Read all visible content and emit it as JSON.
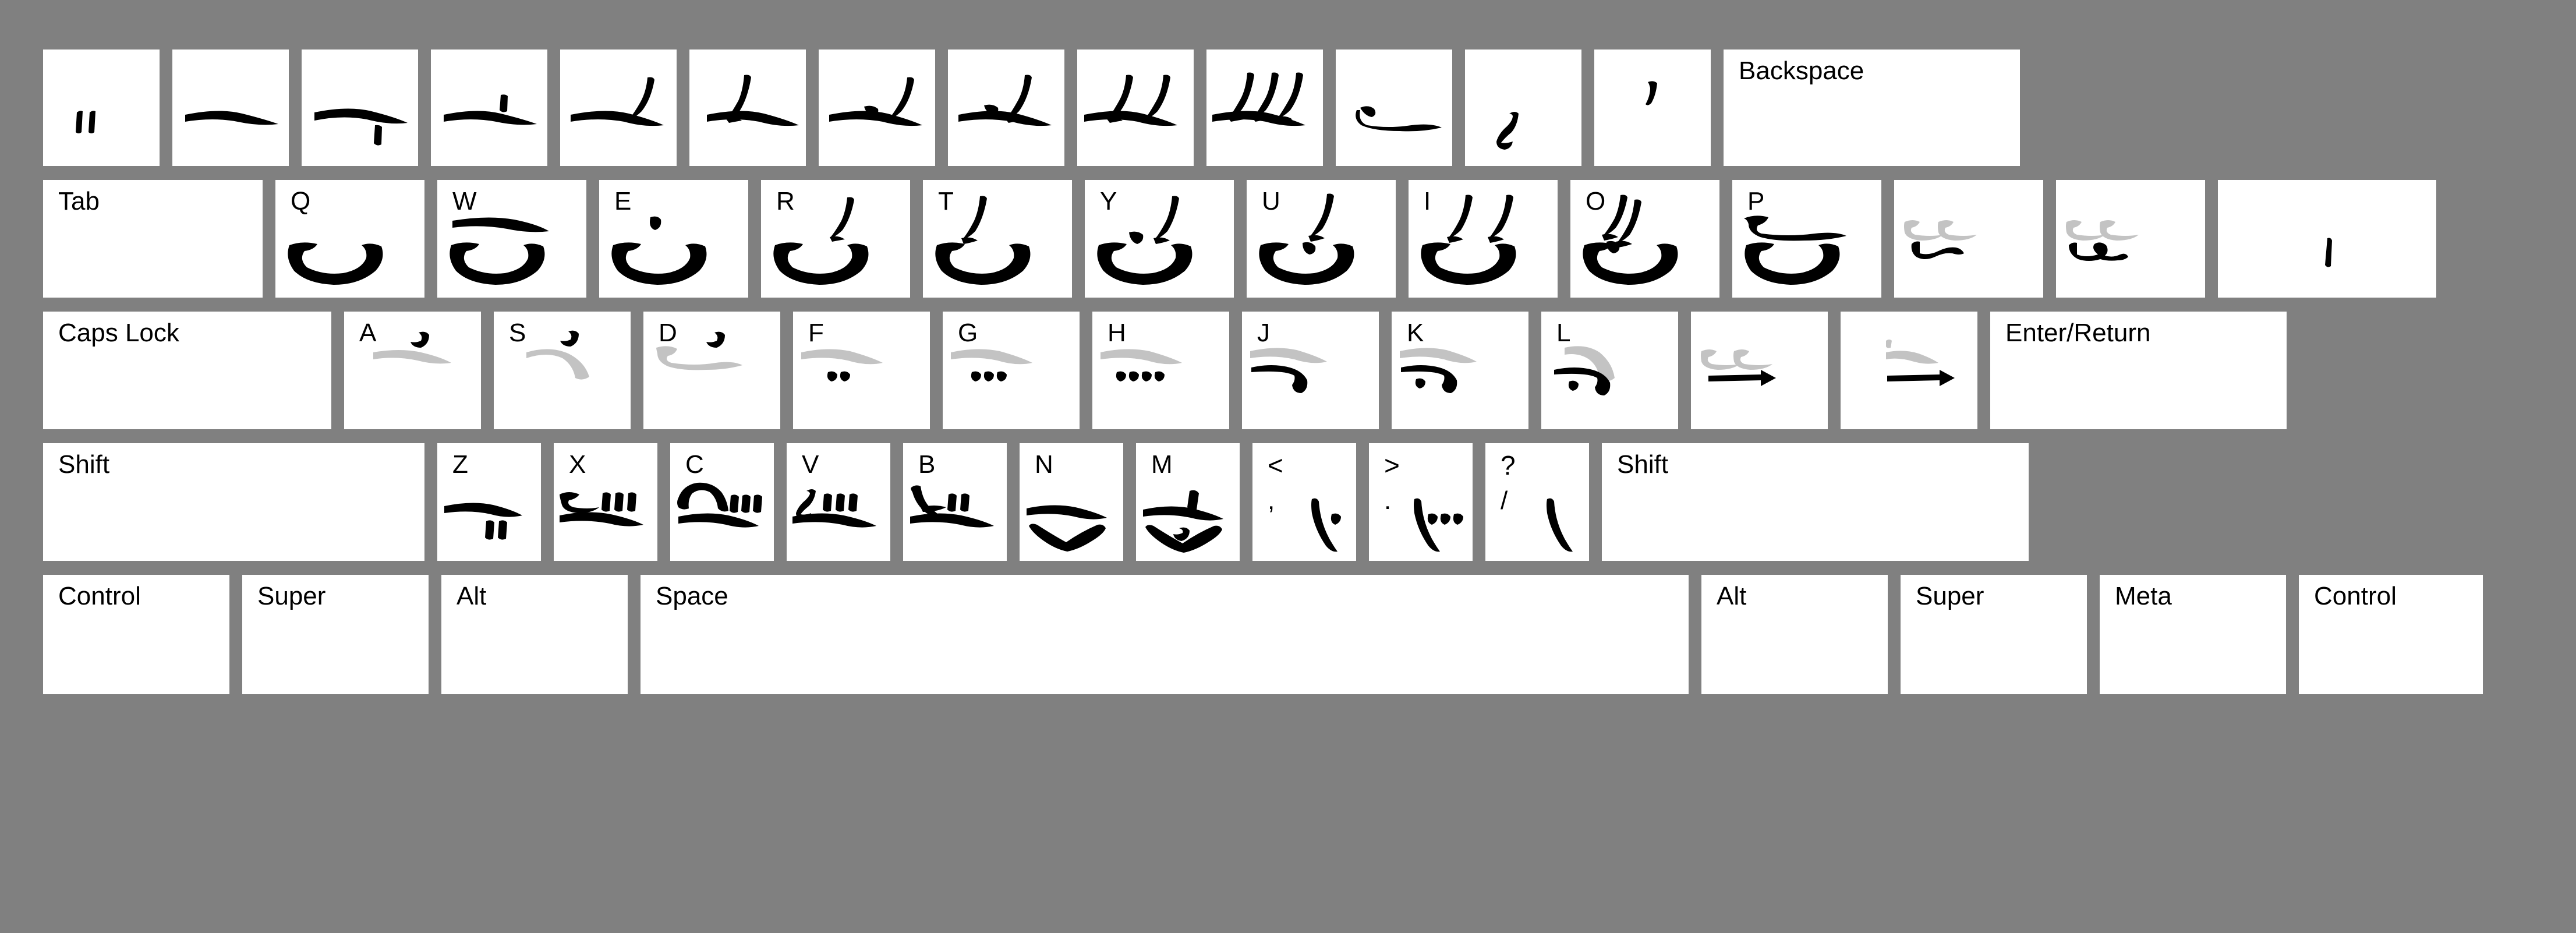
{
  "layout": {
    "name": "shorthand-keyboard",
    "background_color": "#808080",
    "key_color": "#ffffff",
    "ink_color": "#000000",
    "ghost_ink_color": "#c3c3c3",
    "rows": 5
  },
  "rows": [
    {
      "id": "row-number",
      "keys": [
        {
          "id": "k-backtick",
          "label": "",
          "glyph": "two-short-ticks"
        },
        {
          "id": "k-1",
          "label": "",
          "glyph": "long-stroke"
        },
        {
          "id": "k-2",
          "label": "",
          "glyph": "long-stroke-tick-below"
        },
        {
          "id": "k-3",
          "label": "",
          "glyph": "long-stroke-tick-above"
        },
        {
          "id": "k-4",
          "label": "",
          "glyph": "long-stroke-hook-right"
        },
        {
          "id": "k-5",
          "label": "",
          "glyph": "long-stroke-tall-hook"
        },
        {
          "id": "k-6",
          "label": "",
          "glyph": "long-stroke-dot-hook"
        },
        {
          "id": "k-7",
          "label": "",
          "glyph": "long-stroke-hook-mid"
        },
        {
          "id": "k-8",
          "label": "",
          "glyph": "long-stroke-double-hook"
        },
        {
          "id": "k-9",
          "label": "",
          "glyph": "long-stroke-triple-hook"
        },
        {
          "id": "k-0",
          "label": "",
          "glyph": "curved-hook-stroke"
        },
        {
          "id": "k-minus",
          "label": "",
          "glyph": "small-s-curve"
        },
        {
          "id": "k-equal",
          "label": "",
          "glyph": "apostrophe-comma"
        },
        {
          "id": "k-backspace",
          "label": "Backspace",
          "glyph": ""
        }
      ]
    },
    {
      "id": "row-qwerty",
      "keys": [
        {
          "id": "k-tab",
          "label": "Tab",
          "glyph": ""
        },
        {
          "id": "k-q",
          "label": "Q",
          "glyph": "cup-curve"
        },
        {
          "id": "k-w",
          "label": "W",
          "glyph": "bar-over-cup"
        },
        {
          "id": "k-e",
          "label": "E",
          "glyph": "tick-over-cup"
        },
        {
          "id": "k-r",
          "label": "R",
          "glyph": "hook-over-cup"
        },
        {
          "id": "k-t",
          "label": "T",
          "glyph": "tall-hook-over-cup"
        },
        {
          "id": "k-y",
          "label": "Y",
          "glyph": "dot-hook-over-cup"
        },
        {
          "id": "k-u",
          "label": "U",
          "glyph": "hook-dot-over-cup"
        },
        {
          "id": "k-i",
          "label": "I",
          "glyph": "double-hook-over-cup"
        },
        {
          "id": "k-o",
          "label": "O",
          "glyph": "triple-hook-over-cup"
        },
        {
          "id": "k-p",
          "label": "P",
          "glyph": "hook-bar-over-cup"
        },
        {
          "id": "k-lbracket",
          "label": "",
          "glyph": "ghost-pair-over-wave"
        },
        {
          "id": "k-rbracket",
          "label": "",
          "glyph": "ghost-pair-over-loop"
        },
        {
          "id": "k-backslash",
          "label": "",
          "glyph": "vertical-bar"
        }
      ]
    },
    {
      "id": "row-home",
      "keys": [
        {
          "id": "k-capslock",
          "label": "Caps Lock",
          "glyph": ""
        },
        {
          "id": "k-a",
          "label": "A",
          "glyph": "hookmark-over-ghost-stroke"
        },
        {
          "id": "k-s",
          "label": "S",
          "glyph": "hookmark-over-ghost-arc"
        },
        {
          "id": "k-d",
          "label": "D",
          "glyph": "hookmark-over-ghost-hook"
        },
        {
          "id": "k-f",
          "label": "F",
          "glyph": "ghost-stroke-two-dots"
        },
        {
          "id": "k-g",
          "label": "G",
          "glyph": "ghost-stroke-three-dots"
        },
        {
          "id": "k-h",
          "label": "H",
          "glyph": "ghost-stroke-four-dots"
        },
        {
          "id": "k-j",
          "label": "J",
          "glyph": "ghost-stroke-over-hook"
        },
        {
          "id": "k-k",
          "label": "K",
          "glyph": "ghost-stroke-over-hook-dot"
        },
        {
          "id": "k-l",
          "label": "L",
          "glyph": "ghost-arc-over-hook-dot"
        },
        {
          "id": "k-semicolon",
          "label": "",
          "glyph": "ghost-pair-over-arrow"
        },
        {
          "id": "k-quote",
          "label": "",
          "glyph": "ghost-single-over-arrow"
        },
        {
          "id": "k-enter",
          "label": "Enter/Return",
          "glyph": ""
        }
      ]
    },
    {
      "id": "row-bottom-alpha",
      "keys": [
        {
          "id": "k-lshift",
          "label": "Shift",
          "glyph": ""
        },
        {
          "id": "k-z",
          "label": "Z",
          "glyph": "stroke-two-ticks-below"
        },
        {
          "id": "k-x",
          "label": "X",
          "glyph": "hook-three-ticks-stroke"
        },
        {
          "id": "k-c",
          "label": "C",
          "glyph": "arc-three-ticks-stroke"
        },
        {
          "id": "k-v",
          "label": "V",
          "glyph": "s-three-ticks-stroke"
        },
        {
          "id": "k-b",
          "label": "B",
          "glyph": "cross-three-ticks-stroke"
        },
        {
          "id": "k-n",
          "label": "N",
          "glyph": "stroke-over-check"
        },
        {
          "id": "k-m",
          "label": "M",
          "glyph": "tick-stroke-loop-check"
        },
        {
          "id": "k-comma",
          "label": "<",
          "sublabel": ",",
          "glyph": "down-curve-one-dot"
        },
        {
          "id": "k-period",
          "label": ">",
          "sublabel": ".",
          "glyph": "down-curve-three-dots"
        },
        {
          "id": "k-slash",
          "label": "?",
          "sublabel": "/",
          "glyph": "down-curve-plain"
        },
        {
          "id": "k-rshift",
          "label": "Shift",
          "glyph": ""
        }
      ]
    },
    {
      "id": "row-modifiers",
      "keys": [
        {
          "id": "k-lcontrol",
          "label": "Control",
          "glyph": ""
        },
        {
          "id": "k-lsuper",
          "label": "Super",
          "glyph": ""
        },
        {
          "id": "k-lalt",
          "label": "Alt",
          "glyph": ""
        },
        {
          "id": "k-space",
          "label": "Space",
          "glyph": ""
        },
        {
          "id": "k-ralt",
          "label": "Alt",
          "glyph": ""
        },
        {
          "id": "k-rsuper",
          "label": "Super",
          "glyph": ""
        },
        {
          "id": "k-meta",
          "label": "Meta",
          "glyph": ""
        },
        {
          "id": "k-rcontrol",
          "label": "Control",
          "glyph": ""
        }
      ]
    }
  ]
}
